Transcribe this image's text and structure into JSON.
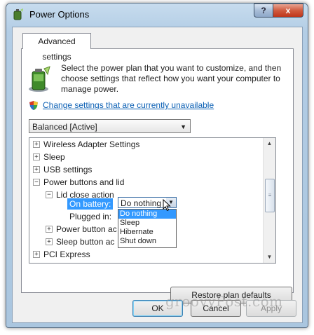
{
  "window": {
    "title": "Power Options",
    "help_label": "?",
    "close_label": "x"
  },
  "tab": {
    "label": "Advanced settings"
  },
  "intro": {
    "text": "Select the power plan that you want to customize, and then choose settings that reflect how you want your computer to manage power."
  },
  "change_link": "Change settings that are currently unavailable",
  "plan_select": {
    "value": "Balanced [Active]"
  },
  "tree": {
    "items": [
      {
        "label": "Wireless Adapter Settings",
        "expander": "+"
      },
      {
        "label": "Sleep",
        "expander": "+"
      },
      {
        "label": "USB settings",
        "expander": "+"
      },
      {
        "label": "Power buttons and lid",
        "expander": "−"
      },
      {
        "label": "Lid close action",
        "expander": "−"
      },
      {
        "label": "On battery:"
      },
      {
        "label": "Plugged in:"
      },
      {
        "label": "Power button ac",
        "expander": "+"
      },
      {
        "label": "Sleep button ac",
        "expander": "+"
      },
      {
        "label": "PCI Express",
        "expander": "+"
      }
    ],
    "combo_value": "Do nothing",
    "dropdown_options": [
      "Do nothing",
      "Sleep",
      "Hibernate",
      "Shut down"
    ],
    "selected_option": "Do nothing"
  },
  "buttons": {
    "restore": "Restore plan defaults",
    "ok": "OK",
    "cancel": "Cancel",
    "apply": "Apply"
  },
  "watermark": "groovyPost.com",
  "icons": [
    "battery-plan-icon",
    "shield-icon",
    "power-options-icon",
    "mouse-cursor-icon"
  ]
}
